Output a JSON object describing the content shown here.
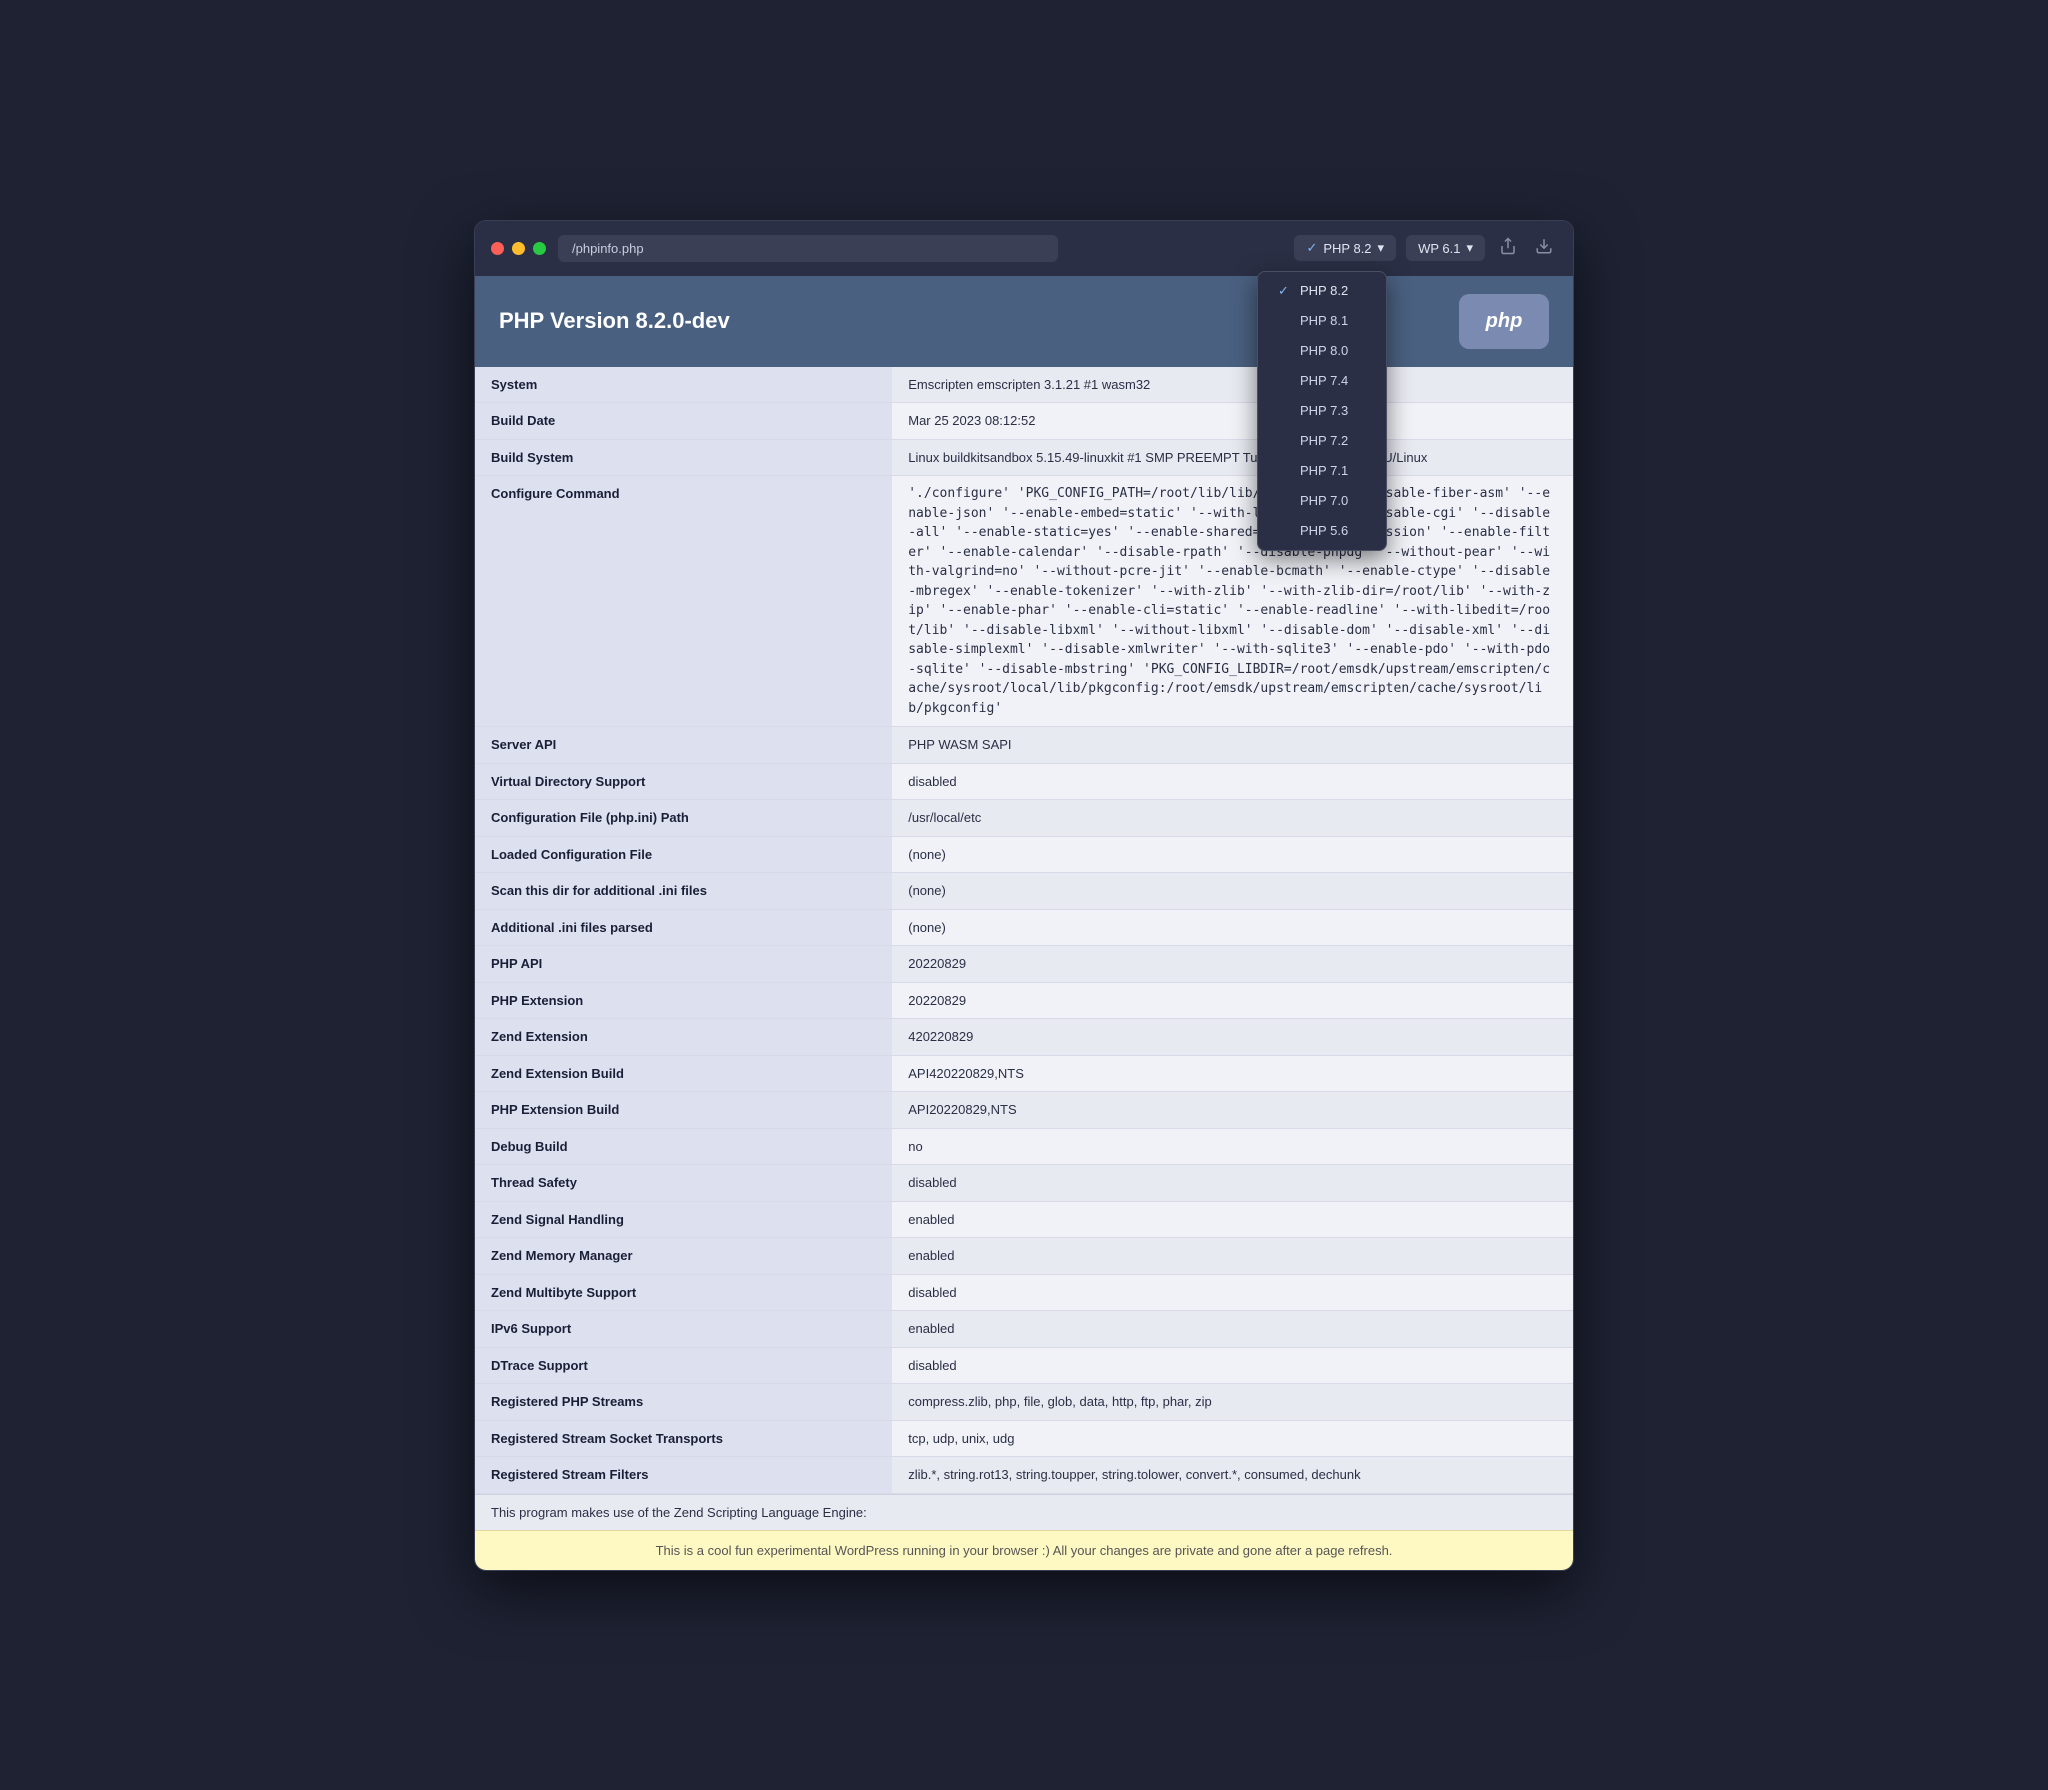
{
  "window": {
    "url": "/phpinfo.php",
    "traffic_lights": [
      "close",
      "minimize",
      "maximize"
    ]
  },
  "header": {
    "php_version_title": "PHP Version 8.2.0-dev",
    "php_logo_text": "php"
  },
  "php_selector": {
    "current": "PHP 8.2",
    "options": [
      {
        "label": "PHP 8.2",
        "selected": true
      },
      {
        "label": "PHP 8.1",
        "selected": false
      },
      {
        "label": "PHP 8.0",
        "selected": false
      },
      {
        "label": "PHP 7.4",
        "selected": false
      },
      {
        "label": "PHP 7.3",
        "selected": false
      },
      {
        "label": "PHP 7.2",
        "selected": false
      },
      {
        "label": "PHP 7.1",
        "selected": false
      },
      {
        "label": "PHP 7.0",
        "selected": false
      },
      {
        "label": "PHP 5.6",
        "selected": false
      }
    ]
  },
  "wp_selector": {
    "current": "WP 6.1"
  },
  "table_rows": [
    {
      "key": "System",
      "value": "Emscripten emscripten 3.1.21 #1 wasm32"
    },
    {
      "key": "Build Date",
      "value": "Mar 25 2023 08:12:52"
    },
    {
      "key": "Build System",
      "value": "Linux buildkitsandbox 5.15.49-linuxkit #1 SMP PREEMPT Tue Sep 13 aarch64 GNU/Linux"
    },
    {
      "key": "Configure Command",
      "value": "'./configure' 'PKG_CONFIG_PATH=/root/lib/lib/pkgconfig' '--disable-fiber-asm' '--enable-json' '--enable-embed=static' '--with-layout=GNU' '--disable-cgi' '--disable-all' '--enable-static=yes' '--enable-shared=no' '--enable-session' '--enable-filter' '--enable-calendar' '--disable-rpath' '--disable-phpdg' '--without-pear' '--with-valgrind=no' '--without-pcre-jit' '--enable-bcmath' '--enable-ctype' '--disable-mbregex' '--enable-tokenizer' '--with-zlib' '--with-zlib-dir=/root/lib' '--with-zip' '--enable-phar' '--enable-cli=static' '--enable-readline' '--with-libedit=/root/lib' '--disable-libxml' '--without-libxml' '--disable-dom' '--disable-xml' '--disable-simplexml' '--disable-xmlwriter' '--with-sqlite3' '--enable-pdo' '--with-pdo-sqlite' '--disable-mbstring' 'PKG_CONFIG_LIBDIR=/root/emsdk/upstream/emscripten/cache/sysroot/local/lib/pkgconfig:/root/emsdk/upstream/emscripten/cache/sysroot/lib/pkgconfig'"
    },
    {
      "key": "Server API",
      "value": "PHP WASM SAPI"
    },
    {
      "key": "Virtual Directory Support",
      "value": "disabled"
    },
    {
      "key": "Configuration File (php.ini) Path",
      "value": "/usr/local/etc"
    },
    {
      "key": "Loaded Configuration File",
      "value": "(none)"
    },
    {
      "key": "Scan this dir for additional .ini files",
      "value": "(none)"
    },
    {
      "key": "Additional .ini files parsed",
      "value": "(none)"
    },
    {
      "key": "PHP API",
      "value": "20220829"
    },
    {
      "key": "PHP Extension",
      "value": "20220829"
    },
    {
      "key": "Zend Extension",
      "value": "420220829"
    },
    {
      "key": "Zend Extension Build",
      "value": "API420220829,NTS"
    },
    {
      "key": "PHP Extension Build",
      "value": "API20220829,NTS"
    },
    {
      "key": "Debug Build",
      "value": "no"
    },
    {
      "key": "Thread Safety",
      "value": "disabled"
    },
    {
      "key": "Zend Signal Handling",
      "value": "enabled"
    },
    {
      "key": "Zend Memory Manager",
      "value": "enabled"
    },
    {
      "key": "Zend Multibyte Support",
      "value": "disabled"
    },
    {
      "key": "IPv6 Support",
      "value": "enabled"
    },
    {
      "key": "DTrace Support",
      "value": "disabled"
    },
    {
      "key": "Registered PHP Streams",
      "value": "compress.zlib, php, file, glob, data, http, ftp, phar, zip"
    },
    {
      "key": "Registered Stream Socket Transports",
      "value": "tcp, udp, unix, udg"
    },
    {
      "key": "Registered Stream Filters",
      "value": "zlib.*, string.rot13, string.toupper, string.tolower, convert.*, consumed, dechunk"
    }
  ],
  "footer": {
    "text": "This program makes use of the Zend Scripting Language Engine:"
  },
  "status_bar": {
    "text": "This is a cool fun experimental WordPress running in your browser :) All your changes are private and gone after a page refresh."
  }
}
